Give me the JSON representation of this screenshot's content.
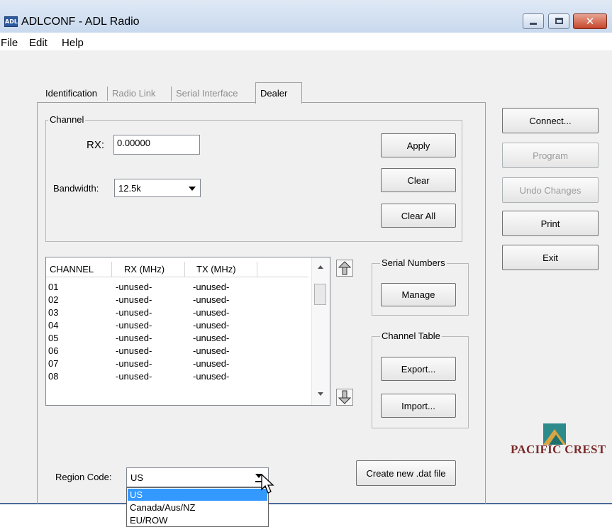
{
  "window": {
    "app_icon_text": "ADL",
    "title": "ADLCONF - ADL Radio"
  },
  "menu": [
    "File",
    "Edit",
    "Help"
  ],
  "tabs": [
    {
      "label": "Identification",
      "enabled": true
    },
    {
      "label": "Radio Link",
      "enabled": false
    },
    {
      "label": "Serial Interface",
      "enabled": false
    },
    {
      "label": "Dealer",
      "enabled": true,
      "active": true
    }
  ],
  "channel_group": {
    "label": "Channel",
    "rx_label": "RX:",
    "rx_value": "0.00000",
    "bandwidth_label": "Bandwidth:",
    "bandwidth_value": "12.5k"
  },
  "buttons": {
    "apply": "Apply",
    "clear": "Clear",
    "clear_all": "Clear All",
    "connect": "Connect...",
    "program": "Program",
    "undo": "Undo Changes",
    "print": "Print",
    "exit": "Exit",
    "manage": "Manage",
    "export": "Export...",
    "import": "Import...",
    "create_dat": "Create new .dat file"
  },
  "serial_group": {
    "label": "Serial Numbers"
  },
  "channel_table_group": {
    "label": "Channel Table"
  },
  "channel_list": {
    "columns": [
      "CHANNEL",
      "RX (MHz)",
      "TX (MHz)"
    ],
    "rows": [
      [
        "01",
        "-unused-",
        "-unused-"
      ],
      [
        "02",
        "-unused-",
        "-unused-"
      ],
      [
        "03",
        "-unused-",
        "-unused-"
      ],
      [
        "04",
        "-unused-",
        "-unused-"
      ],
      [
        "05",
        "-unused-",
        "-unused-"
      ],
      [
        "06",
        "-unused-",
        "-unused-"
      ],
      [
        "07",
        "-unused-",
        "-unused-"
      ],
      [
        "08",
        "-unused-",
        "-unused-"
      ]
    ]
  },
  "region": {
    "label": "Region Code:",
    "value": "US",
    "options": [
      "US",
      "Canada/Aus/NZ",
      "EU/ROW"
    ],
    "highlighted": "US"
  },
  "logo": {
    "text": "PACIFIC CREST"
  },
  "colors": {
    "logo_text": "#7b2a2a",
    "selection": "#3399ff",
    "logo_teal": "#2e8b8b",
    "logo_gold": "#d9a441"
  }
}
